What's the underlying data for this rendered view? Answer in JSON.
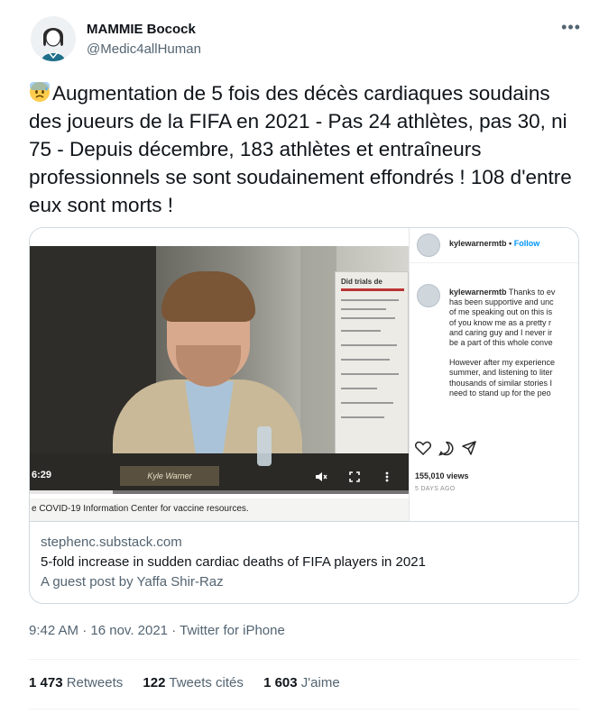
{
  "author": {
    "name": "MAMMIE Bocock",
    "handle": "@Medic4allHuman"
  },
  "more_label": "•••",
  "tweet_text": "Augmentation de 5 fois des décès cardiaques soudains des joueurs de la FIFA en 2021 - Pas 24 athlètes, pas 30, ni 75 - Depuis décembre, 183 athlètes et entraîneurs professionnels se sont soudainement effondrés ! 108 d'entre eux sont morts !",
  "emoji": "anxious-face-with-sweat",
  "media": {
    "video_time": "6:29",
    "nameplate": "Kyle Warner",
    "slide_title": "Did trials de",
    "caption": "e COVID-19 Information Center for vaccine resources.",
    "progress": 0.22
  },
  "instagram": {
    "username": "kylewarnermtb",
    "follow_label": "Follow",
    "dot": "•",
    "body_lines": [
      "Thanks to ev",
      "has been supportive and unc",
      "of me speaking out on this is",
      "of you know me as a pretty r",
      "and caring guy and I never ir",
      "be a part of this whole conve",
      "",
      "However after my experience",
      "summer, and listening to liter",
      "thousands of similar stories I",
      "need to stand up for the peo"
    ],
    "views": "155,010 views",
    "ago": "5 DAYS AGO"
  },
  "link_card": {
    "domain": "stephenc.substack.com",
    "title": "5-fold increase in sudden cardiac deaths of FIFA players in 2021",
    "description": "A guest post by Yaffa Shir-Raz"
  },
  "meta": {
    "time": "9:42 AM",
    "sep": "·",
    "date": "16 nov. 2021",
    "source": "Twitter for iPhone"
  },
  "stats": {
    "retweets_count": "1 473",
    "retweets_label": "Retweets",
    "quotes_count": "122",
    "quotes_label": "Tweets cités",
    "likes_count": "1 603",
    "likes_label": "J'aime"
  },
  "colors": {
    "text": "#0f1419",
    "secondary": "#536471",
    "border": "#cfd9de",
    "ig_blue": "#0095f6"
  }
}
